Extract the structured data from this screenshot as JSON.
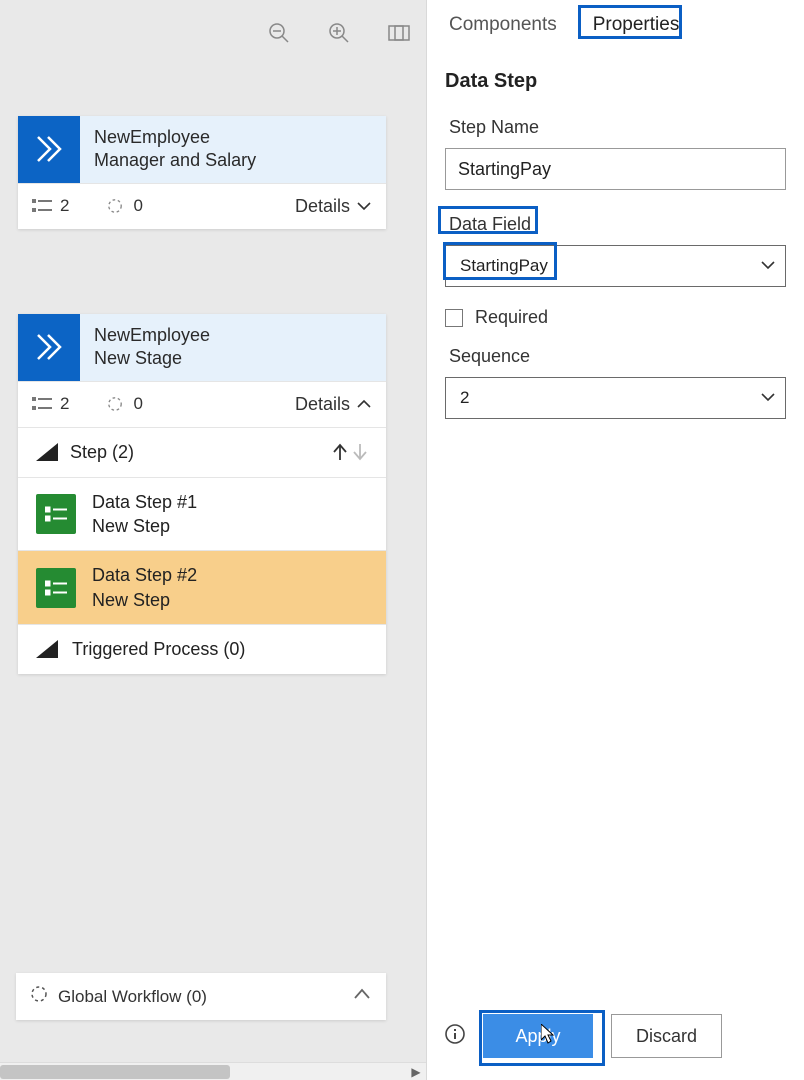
{
  "tabs": {
    "components": "Components",
    "properties": "Properties"
  },
  "canvas": {
    "stage1": {
      "title1": "NewEmployee",
      "title2": "Manager and Salary",
      "count1": "2",
      "count2": "0",
      "details_label": "Details"
    },
    "stage2": {
      "title1": "NewEmployee",
      "title2": "New Stage",
      "count1": "2",
      "count2": "0",
      "details_label": "Details",
      "steps_header": "Step (2)",
      "step1": {
        "ln1": "Data Step #1",
        "ln2": "New Step"
      },
      "step2": {
        "ln1": "Data Step #2",
        "ln2": "New Step"
      },
      "triggered": "Triggered Process (0)"
    },
    "global_workflow": "Global Workflow (0)"
  },
  "panel": {
    "section_title": "Data Step",
    "step_name_label": "Step Name",
    "step_name_value": "StartingPay",
    "data_field_label": "Data Field",
    "data_field_value": "StartingPay",
    "required_label": "Required",
    "sequence_label": "Sequence",
    "sequence_value": "2",
    "apply_label": "Apply",
    "discard_label": "Discard"
  }
}
